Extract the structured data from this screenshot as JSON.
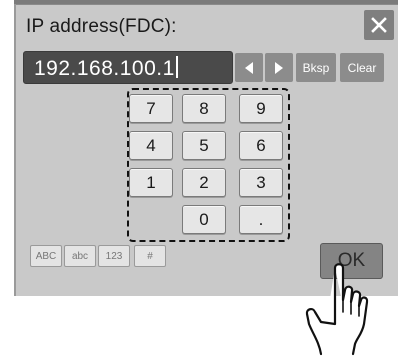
{
  "dialog": {
    "title": "IP address(FDC):",
    "close_icon": "close-icon"
  },
  "input": {
    "value": "192.168.100.1"
  },
  "controls": {
    "left_icon": "left-arrow-icon",
    "right_icon": "right-arrow-icon",
    "bksp_label": "Bksp",
    "clear_label": "Clear"
  },
  "keypad": {
    "keys": [
      "7",
      "8",
      "9",
      "4",
      "5",
      "6",
      "1",
      "2",
      "3",
      "0",
      "."
    ]
  },
  "modes": {
    "abc_upper": "ABC",
    "abc_lower": "abc",
    "num": "123",
    "symbol": "#"
  },
  "ok_label": "OK",
  "colors": {
    "dialog_bg": "#c9c9c9",
    "field_bg": "#4a4a4a",
    "button_gray": "#8c8c8c",
    "key_bg": "#e6e6e6"
  },
  "overlay": {
    "pointer_icon": "hand-pointer-icon"
  }
}
